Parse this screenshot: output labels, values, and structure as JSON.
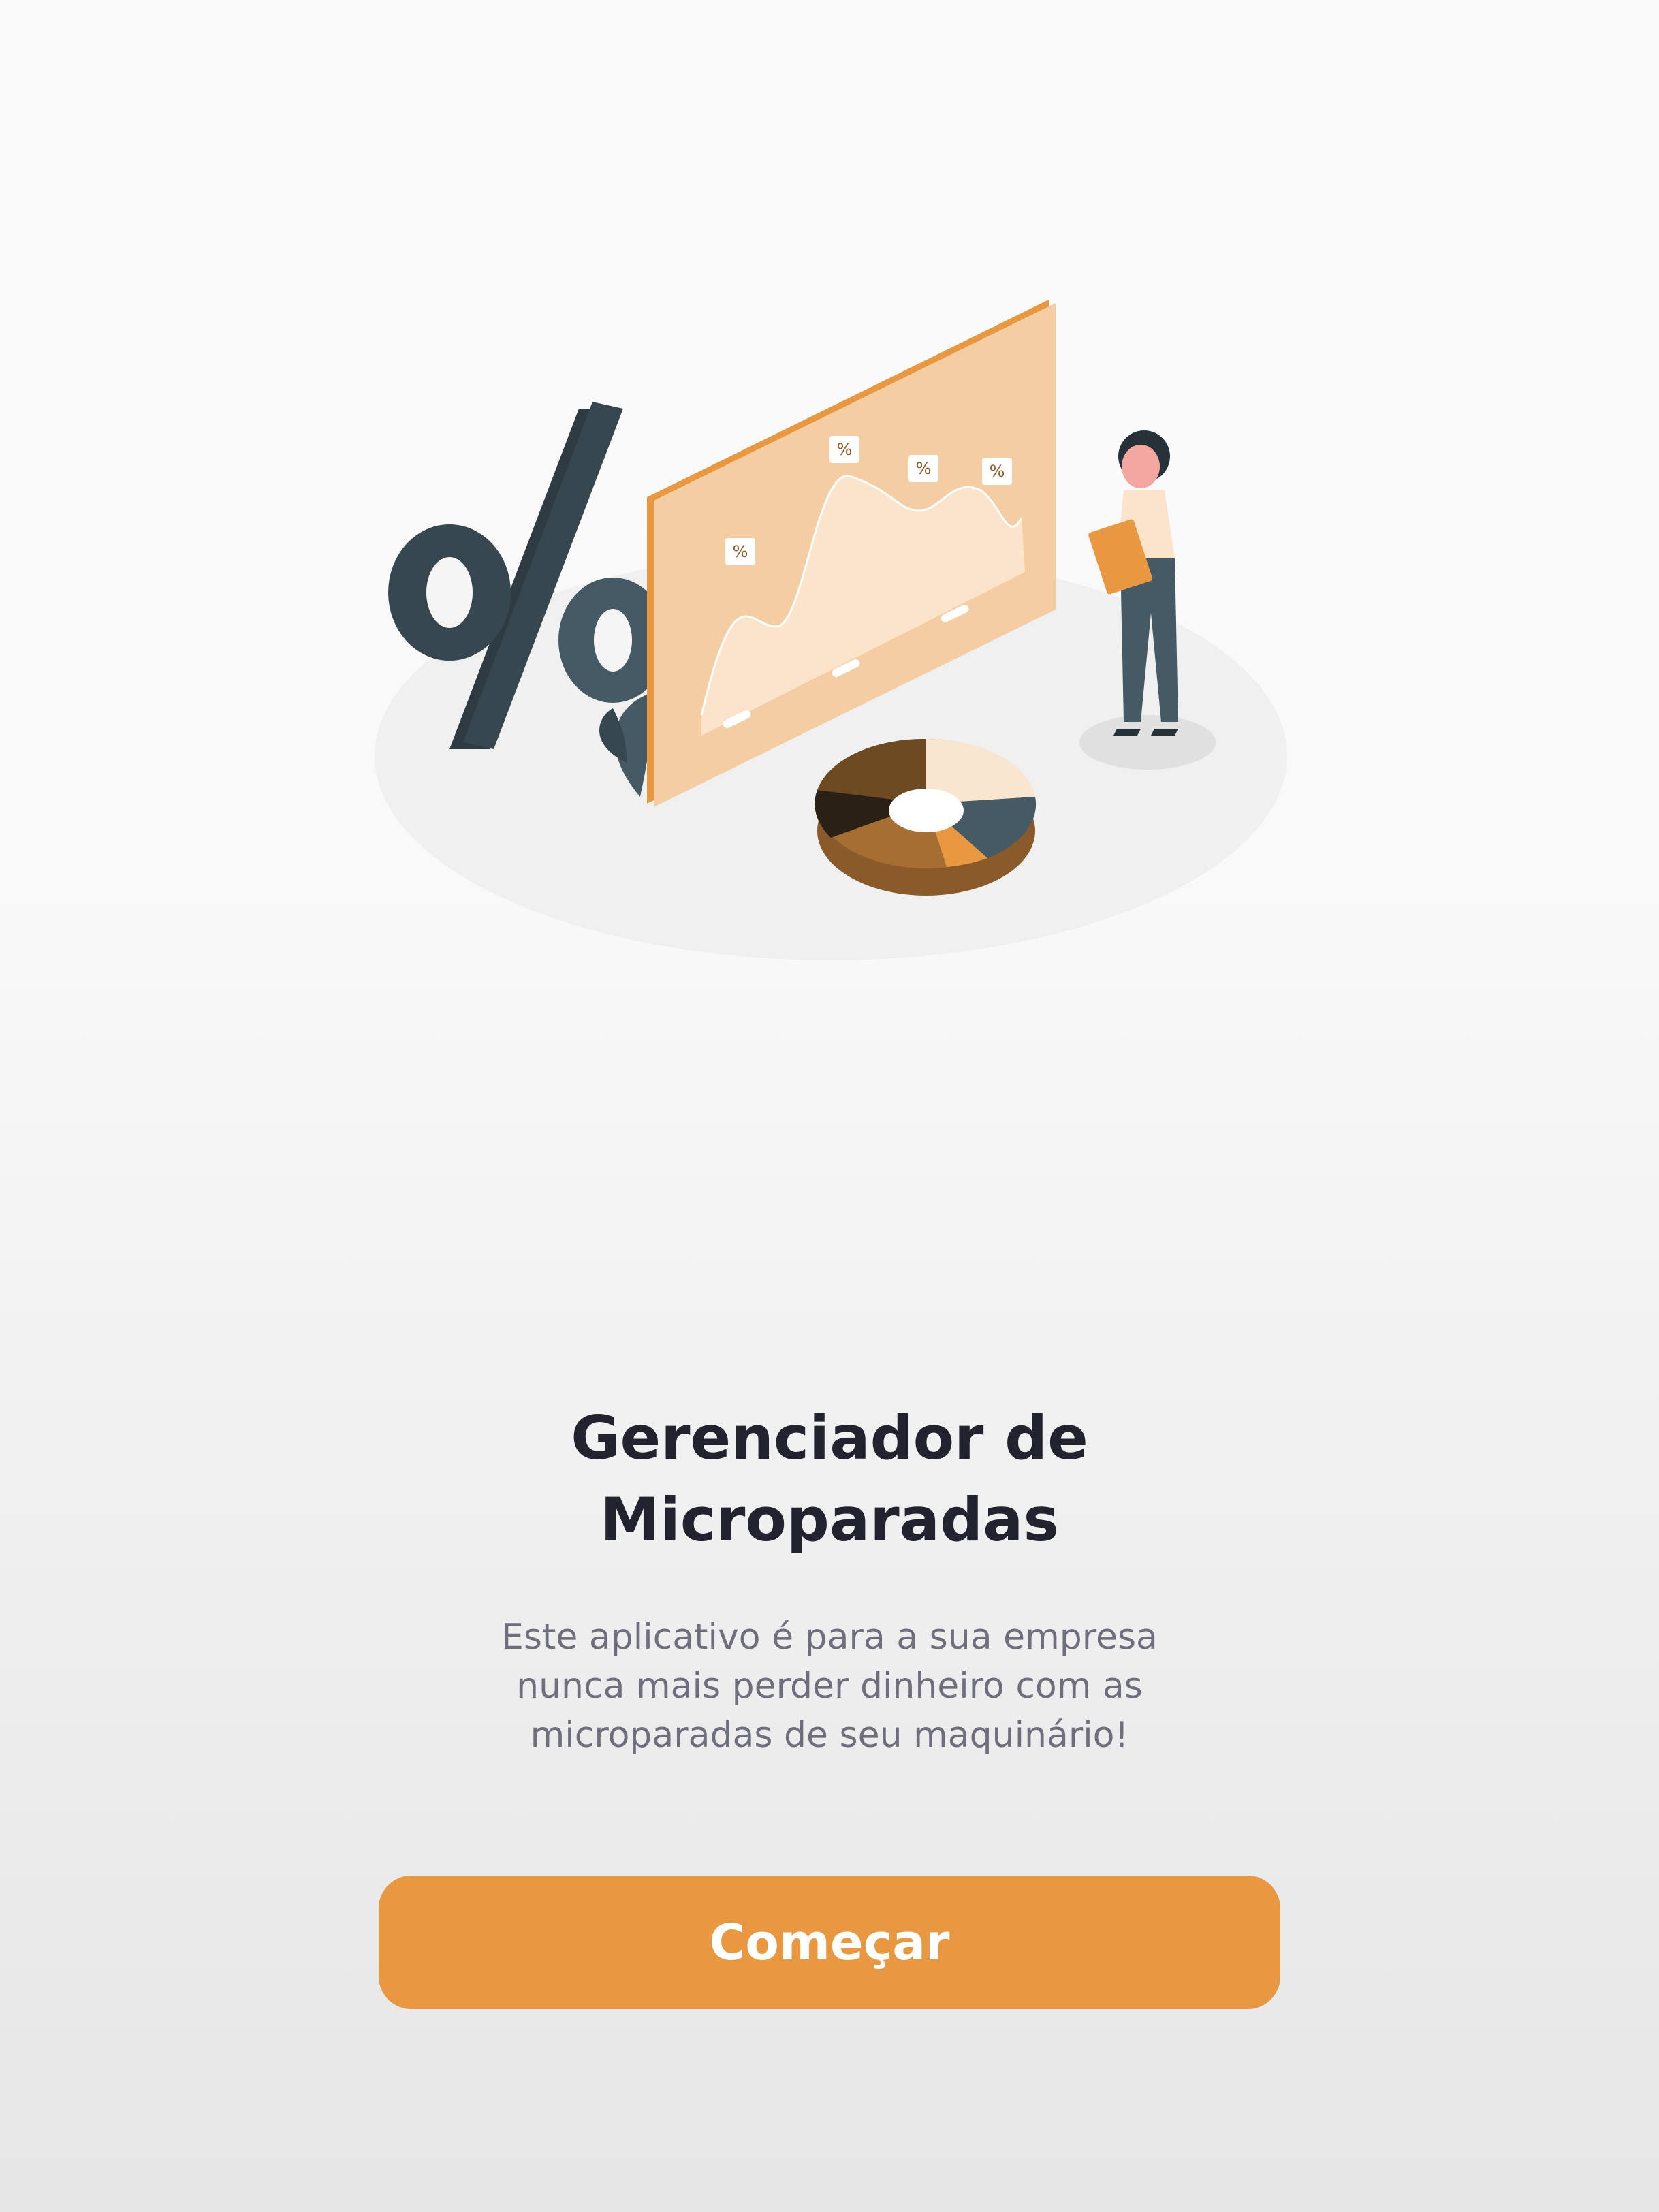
{
  "onboarding": {
    "title_line1": "Gerenciador de",
    "title_line2": "Microparadas",
    "description_line1": "Este aplicativo é para a sua empresa",
    "description_line2": "nunca mais perder dinheiro com as",
    "description_line3": "microparadas de seu maquinário!",
    "start_button_label": "Começar",
    "illustration": {
      "percent_tag": "%"
    }
  },
  "colors": {
    "accent": "#e79840",
    "title": "#23232f",
    "text": "#6e6e7c",
    "slate": "#455a64",
    "peach": "#f5cda2"
  }
}
